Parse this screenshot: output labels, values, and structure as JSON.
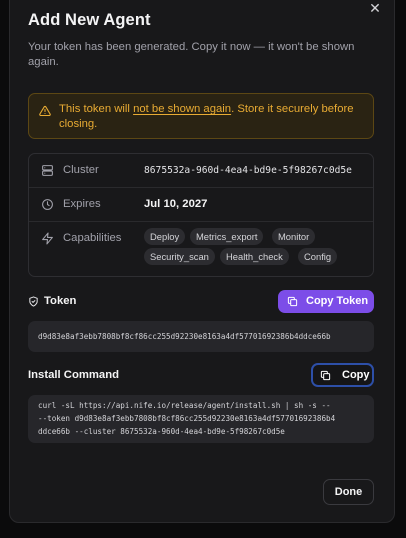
{
  "dialog": {
    "title": "Add New Agent",
    "subtitle": "Your token has been generated. Copy it now — it won't be shown again.",
    "close_icon": "close-icon"
  },
  "warning": {
    "icon": "warning-triangle-icon",
    "text_before": "This token will ",
    "text_emphasis": "not be shown again",
    "text_after": ". Store it securely before closing.",
    "color": "#e8ab33"
  },
  "details": {
    "cluster": {
      "icon": "server-icon",
      "label": "Cluster",
      "value": "8675532a-960d-4ea4-bd9e-5f98267c0d5e"
    },
    "expires": {
      "icon": "clock-icon",
      "label": "Expires",
      "value": "Jul 10, 2027"
    },
    "capabilities": {
      "icon": "bolt-icon",
      "label": "Capabilities",
      "items": [
        "Deploy",
        "Metrics_export",
        "Monitor",
        "Security_scan",
        "Health_check",
        "Config"
      ]
    }
  },
  "token": {
    "icon": "shield-icon",
    "label": "Token",
    "copy_label": "Copy Token",
    "copy_icon": "copy-icon",
    "value": "d9d83e8af3ebb7808bf8cf86cc255d92230e8163a4df57701692386b4ddce66b",
    "accent": "#7c4de8"
  },
  "install": {
    "label": "Install Command",
    "copy_label": "Copy",
    "copy_icon": "copy-icon",
    "lines": [
      "curl -sL https://api.nife.io/release/agent/install.sh | sh -s --",
      "--token d9d83e8af3ebb7808bf8cf86cc255d92230e8163a4df57701692386b4",
      "ddce66b --cluster 8675532a-960d-4ea4-bd9e-5f98267c0d5e"
    ]
  },
  "footer": {
    "done_label": "Done"
  }
}
